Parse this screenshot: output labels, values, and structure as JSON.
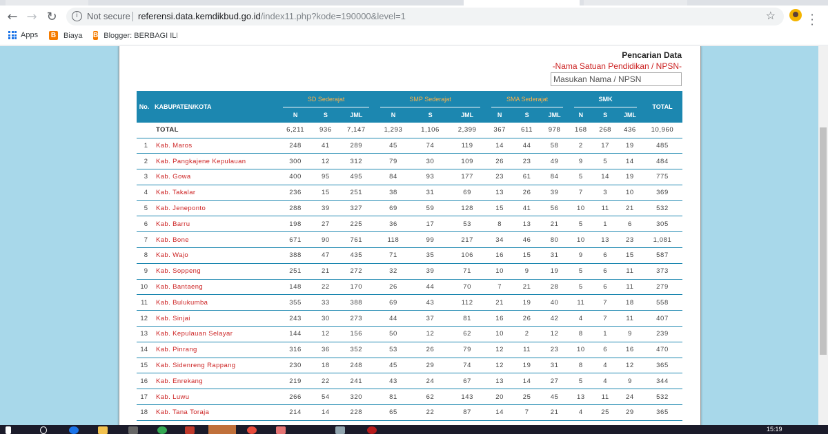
{
  "browser": {
    "security_label": "Not secure",
    "url_host": "referensi.data.kemdikbud.go.id",
    "url_path": "/index11.php?kode=190000&level=1",
    "bookmarks": [
      "Apps",
      "Biaya",
      "Blogger: BERBAGI ILMU"
    ],
    "nav_icons": [
      "back-arrow-icon",
      "forward-arrow-icon",
      "reload-icon"
    ]
  },
  "search": {
    "title": "Pencarian Data",
    "subtitle": "-Nama Satuan Pendidikan / NPSN-",
    "placeholder": "Masukan Nama / NPSN"
  },
  "table": {
    "headers": {
      "no": "No.",
      "region": "KABUPATEN/KOTA",
      "groups": [
        "SD Sederajat",
        "SMP Sederajat",
        "SMA Sederajat",
        "SMK"
      ],
      "sub": [
        "N",
        "S",
        "JML"
      ],
      "total": "TOTAL"
    },
    "total_row": {
      "label": "TOTAL",
      "values": [
        "6,211",
        "936",
        "7,147",
        "1,293",
        "1,106",
        "2,399",
        "367",
        "611",
        "978",
        "168",
        "268",
        "436",
        "10,960"
      ]
    },
    "rows": [
      {
        "no": "1",
        "name": "Kab. Maros",
        "values": [
          "248",
          "41",
          "289",
          "45",
          "74",
          "119",
          "14",
          "44",
          "58",
          "2",
          "17",
          "19",
          "485"
        ]
      },
      {
        "no": "2",
        "name": "Kab. Pangkajene Kepulauan",
        "values": [
          "300",
          "12",
          "312",
          "79",
          "30",
          "109",
          "26",
          "23",
          "49",
          "9",
          "5",
          "14",
          "484"
        ]
      },
      {
        "no": "3",
        "name": "Kab. Gowa",
        "values": [
          "400",
          "95",
          "495",
          "84",
          "93",
          "177",
          "23",
          "61",
          "84",
          "5",
          "14",
          "19",
          "775"
        ]
      },
      {
        "no": "4",
        "name": "Kab. Takalar",
        "values": [
          "236",
          "15",
          "251",
          "38",
          "31",
          "69",
          "13",
          "26",
          "39",
          "7",
          "3",
          "10",
          "369"
        ]
      },
      {
        "no": "5",
        "name": "Kab. Jeneponto",
        "values": [
          "288",
          "39",
          "327",
          "69",
          "59",
          "128",
          "15",
          "41",
          "56",
          "10",
          "11",
          "21",
          "532"
        ]
      },
      {
        "no": "6",
        "name": "Kab. Barru",
        "values": [
          "198",
          "27",
          "225",
          "36",
          "17",
          "53",
          "8",
          "13",
          "21",
          "5",
          "1",
          "6",
          "305"
        ]
      },
      {
        "no": "7",
        "name": "Kab. Bone",
        "values": [
          "671",
          "90",
          "761",
          "118",
          "99",
          "217",
          "34",
          "46",
          "80",
          "10",
          "13",
          "23",
          "1,081"
        ]
      },
      {
        "no": "8",
        "name": "Kab. Wajo",
        "values": [
          "388",
          "47",
          "435",
          "71",
          "35",
          "106",
          "16",
          "15",
          "31",
          "9",
          "6",
          "15",
          "587"
        ]
      },
      {
        "no": "9",
        "name": "Kab. Soppeng",
        "values": [
          "251",
          "21",
          "272",
          "32",
          "39",
          "71",
          "10",
          "9",
          "19",
          "5",
          "6",
          "11",
          "373"
        ]
      },
      {
        "no": "10",
        "name": "Kab. Bantaeng",
        "values": [
          "148",
          "22",
          "170",
          "26",
          "44",
          "70",
          "7",
          "21",
          "28",
          "5",
          "6",
          "11",
          "279"
        ]
      },
      {
        "no": "11",
        "name": "Kab. Bulukumba",
        "values": [
          "355",
          "33",
          "388",
          "69",
          "43",
          "112",
          "21",
          "19",
          "40",
          "11",
          "7",
          "18",
          "558"
        ]
      },
      {
        "no": "12",
        "name": "Kab. Sinjai",
        "values": [
          "243",
          "30",
          "273",
          "44",
          "37",
          "81",
          "16",
          "26",
          "42",
          "4",
          "7",
          "11",
          "407"
        ]
      },
      {
        "no": "13",
        "name": "Kab. Kepulauan Selayar",
        "values": [
          "144",
          "12",
          "156",
          "50",
          "12",
          "62",
          "10",
          "2",
          "12",
          "8",
          "1",
          "9",
          "239"
        ]
      },
      {
        "no": "14",
        "name": "Kab. Pinrang",
        "values": [
          "316",
          "36",
          "352",
          "53",
          "26",
          "79",
          "12",
          "11",
          "23",
          "10",
          "6",
          "16",
          "470"
        ]
      },
      {
        "no": "15",
        "name": "Kab. Sidenreng Rappang",
        "values": [
          "230",
          "18",
          "248",
          "45",
          "29",
          "74",
          "12",
          "19",
          "31",
          "8",
          "4",
          "12",
          "365"
        ]
      },
      {
        "no": "16",
        "name": "Kab. Enrekang",
        "values": [
          "219",
          "22",
          "241",
          "43",
          "24",
          "67",
          "13",
          "14",
          "27",
          "5",
          "4",
          "9",
          "344"
        ]
      },
      {
        "no": "17",
        "name": "Kab. Luwu",
        "values": [
          "266",
          "54",
          "320",
          "81",
          "62",
          "143",
          "20",
          "25",
          "45",
          "13",
          "11",
          "24",
          "532"
        ]
      },
      {
        "no": "18",
        "name": "Kab. Tana Toraja",
        "values": [
          "214",
          "14",
          "228",
          "65",
          "22",
          "87",
          "14",
          "7",
          "21",
          "4",
          "25",
          "29",
          "365"
        ]
      }
    ]
  },
  "taskbar": {
    "clock": "15:19"
  }
}
